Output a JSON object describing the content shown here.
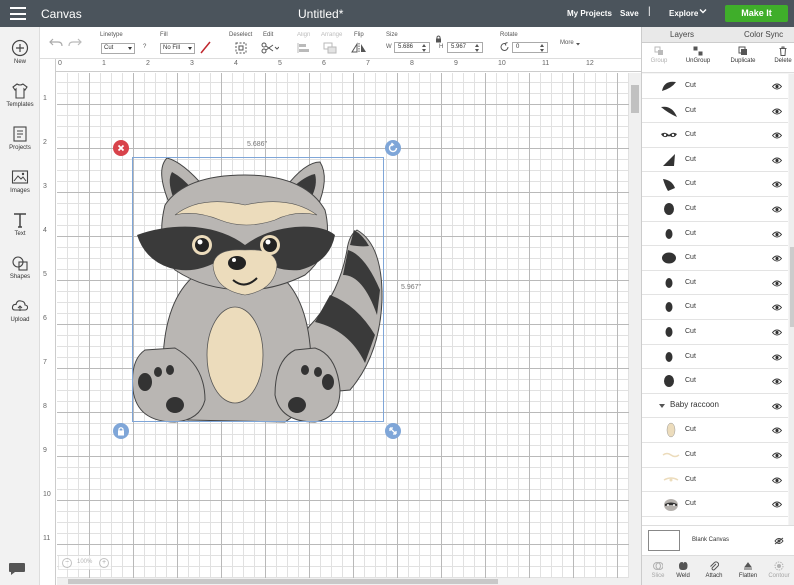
{
  "app": {
    "name": "Canvas",
    "document_title": "Untitled*"
  },
  "header": {
    "my_projects": "My Projects",
    "save": "Save",
    "separator": "|",
    "explore": "Explore",
    "make_it": "Make It"
  },
  "left_tools": [
    {
      "label": "New",
      "icon": "plus-circle-icon"
    },
    {
      "label": "Templates",
      "icon": "shirt-icon"
    },
    {
      "label": "Projects",
      "icon": "projects-icon"
    },
    {
      "label": "Images",
      "icon": "image-icon"
    },
    {
      "label": "Text",
      "icon": "text-icon"
    },
    {
      "label": "Shapes",
      "icon": "shapes-icon"
    },
    {
      "label": "Upload",
      "icon": "upload-icon"
    }
  ],
  "toolbar": {
    "linetype_label": "Linetype",
    "linetype_value": "Cut",
    "help": "?",
    "fill_label": "Fill",
    "fill_value": "No Fill",
    "deselect": "Deselect",
    "edit": "Edit",
    "align": "Align",
    "arrange": "Arrange",
    "flip": "Flip",
    "size_label": "Size",
    "w_label": "W",
    "w_value": "5.686",
    "h_label": "H",
    "h_value": "5.967",
    "rotate_label": "Rotate",
    "rotate_value": "0",
    "more": "More"
  },
  "rulers": {
    "top": [
      "0",
      "1",
      "2",
      "3",
      "4",
      "5",
      "6",
      "7",
      "8",
      "9",
      "10",
      "11",
      "12"
    ],
    "left": [
      "1",
      "2",
      "3",
      "4",
      "5",
      "6",
      "7",
      "8",
      "9",
      "10",
      "11"
    ]
  },
  "canvas": {
    "width_label": "5.686\"",
    "height_label": "5.967\"",
    "zoom": "100%"
  },
  "panel": {
    "tab_layers": "Layers",
    "tab_color_sync": "Color Sync",
    "actions": [
      "Group",
      "UnGroup",
      "Duplicate",
      "Delete"
    ],
    "layers": [
      {
        "name": "Cut",
        "color": "#333333",
        "shape": "ear"
      },
      {
        "name": "Cut",
        "color": "#333333",
        "shape": "ear2"
      },
      {
        "name": "Cut",
        "color": "#333333",
        "shape": "mask"
      },
      {
        "name": "Cut",
        "color": "#333333",
        "shape": "ear3"
      },
      {
        "name": "Cut",
        "color": "#333333",
        "shape": "ear4"
      },
      {
        "name": "Cut",
        "color": "#333333",
        "shape": "oval"
      },
      {
        "name": "Cut",
        "color": "#333333",
        "shape": "oval-s"
      },
      {
        "name": "Cut",
        "color": "#333333",
        "shape": "oval-w"
      },
      {
        "name": "Cut",
        "color": "#333333",
        "shape": "oval-s"
      },
      {
        "name": "Cut",
        "color": "#333333",
        "shape": "oval-s"
      },
      {
        "name": "Cut",
        "color": "#333333",
        "shape": "oval-s"
      },
      {
        "name": "Cut",
        "color": "#333333",
        "shape": "oval-s"
      },
      {
        "name": "Cut",
        "color": "#333333",
        "shape": "oval"
      }
    ],
    "group_name": "Baby raccoon",
    "group_layers": [
      {
        "name": "Cut",
        "color": "#ecdcbc",
        "shape": "belly"
      },
      {
        "name": "Cut",
        "color": "#ecdcbc",
        "shape": "line"
      },
      {
        "name": "Cut",
        "color": "#ecdcbc",
        "shape": "line2"
      },
      {
        "name": "Cut",
        "color": "#b5b1ad",
        "shape": "raccoon"
      }
    ],
    "blank_canvas": "Blank Canvas",
    "bottom_actions": [
      "Slice",
      "Weld",
      "Attach",
      "Flatten",
      "Contour"
    ]
  }
}
